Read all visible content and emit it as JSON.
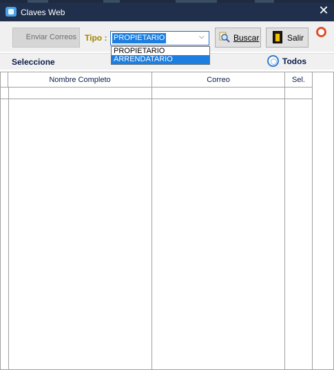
{
  "window": {
    "title": "Claves Web"
  },
  "toolbar": {
    "enviar_label": "Enviar Correos",
    "tipo_label": "Tipo :",
    "tipo_selected": "PROPIETARIO",
    "buscar_label": "Buscar",
    "salir_label": "Salir"
  },
  "dropdown": {
    "options": [
      "PROPIETARIO",
      "ARRENDATARIO"
    ],
    "highlighted": "ARRENDATARIO"
  },
  "selection_bar": {
    "seleccione_label": "Seleccione",
    "todos_label": "Todos"
  },
  "table": {
    "columns": [
      "Nombre Completo",
      "Correo",
      "Sel."
    ],
    "rows": []
  },
  "colors": {
    "titlebar": "#1f2f4c",
    "accent": "#1c7ee0",
    "tipo_label": "#a18300",
    "header_text": "#0b1c4a"
  }
}
